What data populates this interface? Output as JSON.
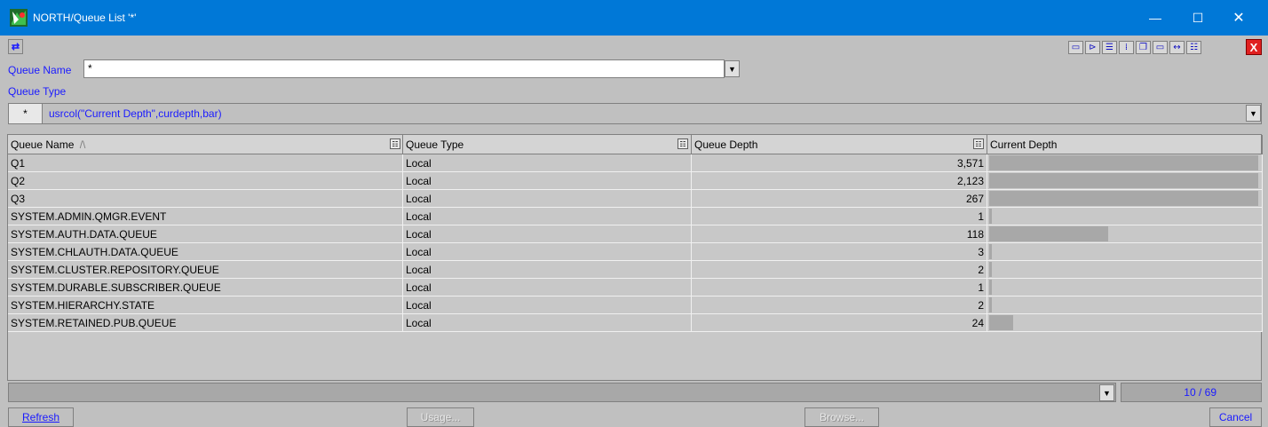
{
  "window": {
    "title": "NORTH/Queue List '*'",
    "minimize_glyph": "—",
    "maximize_glyph": "☐",
    "close_glyph": "✕"
  },
  "toolbar": {
    "swap_glyph": "⇄",
    "icons": [
      "id-card-icon",
      "tree-icon",
      "list-icon",
      "columns-icon",
      "windows-icon",
      "single-window-icon",
      "fit-width-icon",
      "outline-icon"
    ],
    "icon_glyphs": [
      "▭",
      "⊳",
      "☰",
      "⁞",
      "❐",
      "▭",
      "↔",
      "☷"
    ],
    "close_glyph": "X"
  },
  "filters": {
    "queue_name_label": "Queue Name",
    "queue_name_value": "*",
    "queue_type_label": "Queue Type",
    "filter_star": "*",
    "filter_expression": "usrcol(\"Current Depth\",curdepth,bar)"
  },
  "grid": {
    "headers": [
      "Queue Name",
      "Queue Type",
      "Queue Depth",
      "Current Depth"
    ],
    "sort_indicator": "/\\",
    "rows": [
      {
        "name": "Q1",
        "type": "Local",
        "depth": "3,571"
      },
      {
        "name": "Q2",
        "type": "Local",
        "depth": "2,123"
      },
      {
        "name": "Q3",
        "type": "Local",
        "depth": "267"
      },
      {
        "name": "SYSTEM.ADMIN.QMGR.EVENT",
        "type": "Local",
        "depth": "1"
      },
      {
        "name": "SYSTEM.AUTH.DATA.QUEUE",
        "type": "Local",
        "depth": "118"
      },
      {
        "name": "SYSTEM.CHLAUTH.DATA.QUEUE",
        "type": "Local",
        "depth": "3"
      },
      {
        "name": "SYSTEM.CLUSTER.REPOSITORY.QUEUE",
        "type": "Local",
        "depth": "2"
      },
      {
        "name": "SYSTEM.DURABLE.SUBSCRIBER.QUEUE",
        "type": "Local",
        "depth": "1"
      },
      {
        "name": "SYSTEM.HIERARCHY.STATE",
        "type": "Local",
        "depth": "2"
      },
      {
        "name": "SYSTEM.RETAINED.PUB.QUEUE",
        "type": "Local",
        "depth": "24"
      }
    ]
  },
  "status": {
    "count": "10 / 69"
  },
  "buttons": {
    "refresh": "Refresh",
    "usage": "Usage...",
    "browse": "Browse...",
    "cancel": "Cancel"
  },
  "colors": {
    "titlebar": "#0078d7",
    "label_blue": "#1a1aff",
    "grid_bg": "#c8c8c8",
    "bar": "#a8a8a8"
  }
}
